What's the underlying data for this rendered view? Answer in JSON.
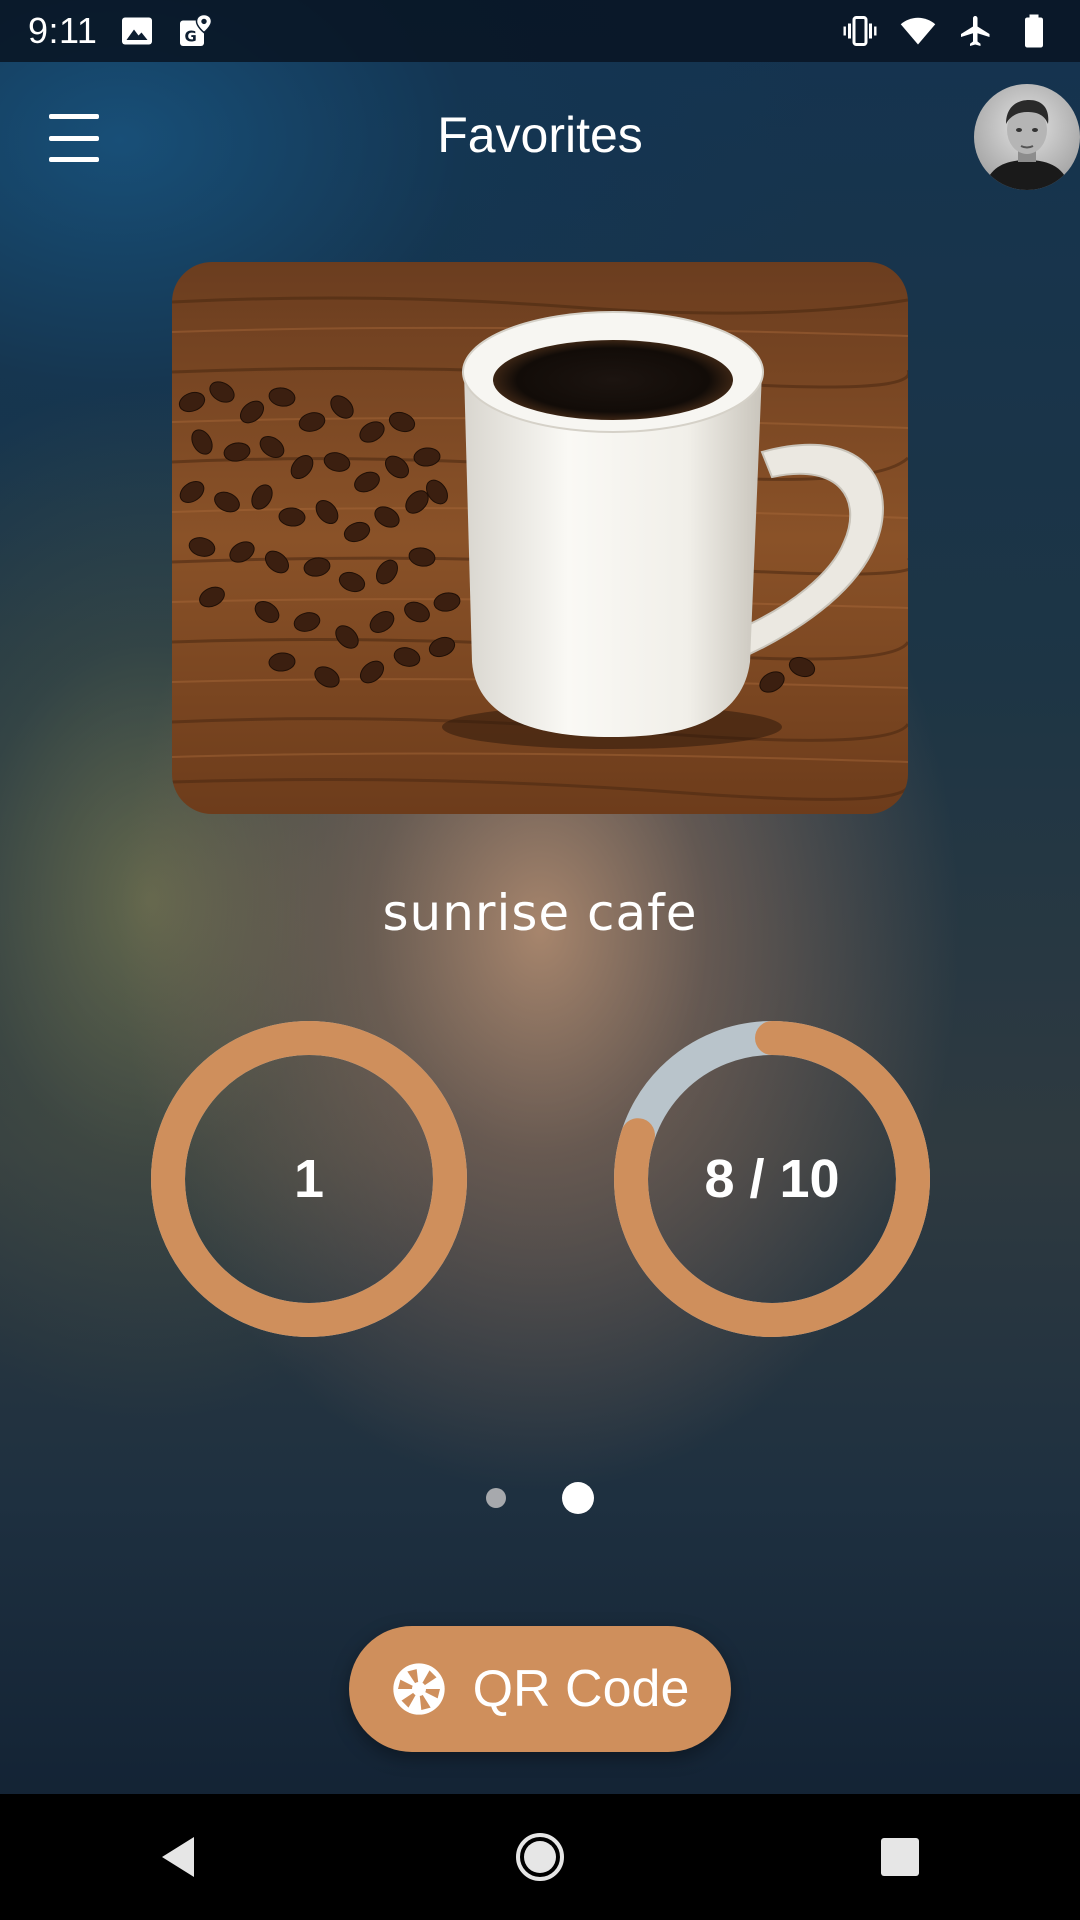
{
  "status_bar": {
    "time": "9:11",
    "left_icons": [
      "image-icon",
      "maps-icon"
    ],
    "right_icons": [
      "vibrate-icon",
      "wifi-icon",
      "airplane-icon",
      "battery-icon"
    ]
  },
  "app_bar": {
    "title": "Favorites",
    "menu_icon": "menu-icon",
    "avatar": "user-avatar"
  },
  "hero": {
    "subject": "coffee-mug-photo"
  },
  "cafe": {
    "name": "sunrise cafe"
  },
  "rings": {
    "left": {
      "label": "1",
      "progress": 1.0
    },
    "right": {
      "label": "8 / 10",
      "progress": 0.8
    }
  },
  "pager": {
    "pages": 2,
    "active_index": 1
  },
  "qr_button": {
    "label": "QR Code",
    "icon": "camera-shutter-icon"
  },
  "nav": {
    "icons": [
      "back-icon",
      "home-icon",
      "recents-icon"
    ]
  },
  "colors": {
    "accent": "#cf8f5c",
    "ring_track": "#b9c4cb",
    "nav_bar": "#000000"
  }
}
